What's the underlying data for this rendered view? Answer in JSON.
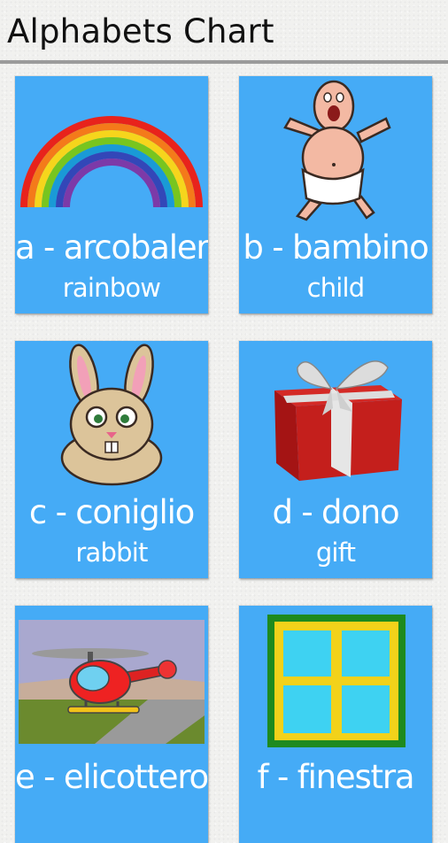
{
  "app": {
    "title": "Alphabets Chart"
  },
  "cards": [
    {
      "italian": "a - arcobaleno",
      "english": "rainbow",
      "icon": "rainbow-icon"
    },
    {
      "italian": "b - bambino",
      "english": "child",
      "icon": "baby-icon"
    },
    {
      "italian": "c - coniglio",
      "english": "rabbit",
      "icon": "rabbit-icon"
    },
    {
      "italian": "d - dono",
      "english": "gift",
      "icon": "gift-box-icon"
    },
    {
      "italian": "e - elicottero",
      "english": "",
      "icon": "helicopter-icon"
    },
    {
      "italian": "f - finestra",
      "english": "",
      "icon": "window-icon"
    }
  ],
  "colors": {
    "card": "#45abf6",
    "text": "#ffffff",
    "rule": "#9b9b9b"
  }
}
